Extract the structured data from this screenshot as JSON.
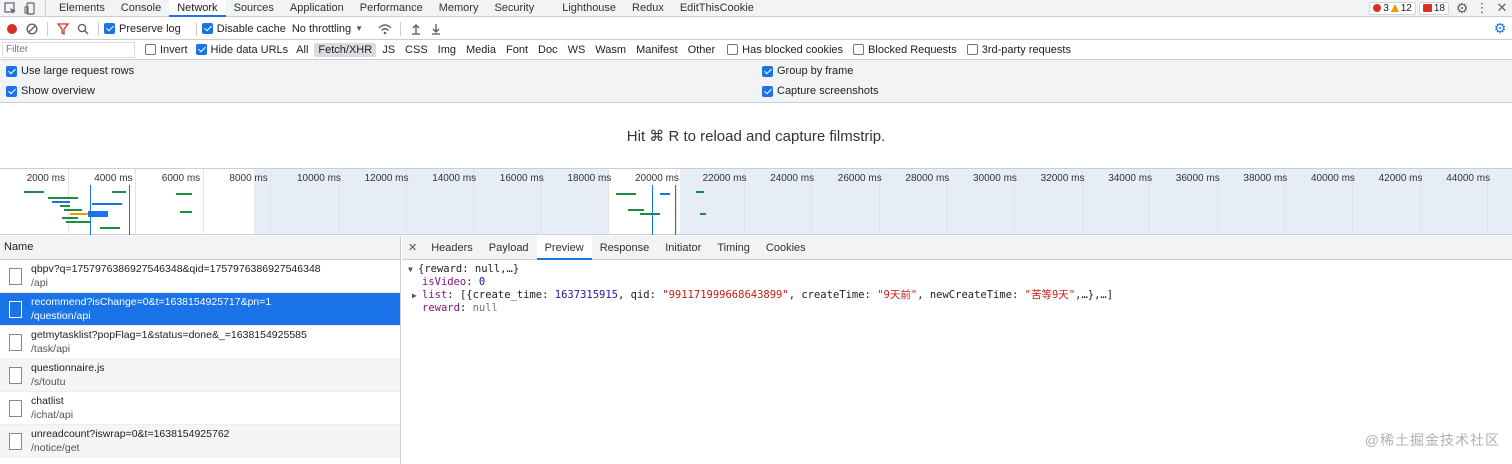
{
  "tabs": [
    {
      "label": "Elements",
      "active": false
    },
    {
      "label": "Console",
      "active": false
    },
    {
      "label": "Network",
      "active": true
    },
    {
      "label": "Sources",
      "active": false
    },
    {
      "label": "Application",
      "active": false
    },
    {
      "label": "Performance",
      "active": false
    },
    {
      "label": "Memory",
      "active": false
    },
    {
      "label": "Security",
      "active": false
    },
    {
      "label": "Lighthouse",
      "active": false
    },
    {
      "label": "Redux",
      "active": false
    },
    {
      "label": "EditThisCookie",
      "active": false
    }
  ],
  "badges": {
    "errors": "3",
    "warnings": "12",
    "issues": "18"
  },
  "toolbar": {
    "preserve_log": "Preserve log",
    "disable_cache": "Disable cache",
    "throttling": "No throttling"
  },
  "filter": {
    "placeholder": "Filter",
    "invert": "Invert",
    "hide_data_urls": "Hide data URLs",
    "types": [
      "All",
      "Fetch/XHR",
      "JS",
      "CSS",
      "Img",
      "Media",
      "Font",
      "Doc",
      "WS",
      "Wasm",
      "Manifest",
      "Other"
    ],
    "selected_type": "Fetch/XHR",
    "has_blocked_cookies": "Has blocked cookies",
    "blocked_requests": "Blocked Requests",
    "third_party": "3rd-party requests"
  },
  "settings": {
    "large_rows": "Use large request rows",
    "show_overview": "Show overview",
    "group_by_frame": "Group by frame",
    "capture_screenshots": "Capture screenshots"
  },
  "filmstrip": {
    "message": "Hit ⌘ R to reload and capture filmstrip."
  },
  "timeline": {
    "ticks": [
      "2000 ms",
      "4000 ms",
      "6000 ms",
      "8000 ms",
      "10000 ms",
      "12000 ms",
      "14000 ms",
      "16000 ms",
      "18000 ms",
      "20000 ms",
      "22000 ms",
      "24000 ms",
      "26000 ms",
      "28000 ms",
      "30000 ms",
      "32000 ms",
      "34000 ms",
      "36000 ms",
      "38000 ms",
      "40000 ms",
      "42000 ms",
      "44000 ms"
    ]
  },
  "list": {
    "header": "Name",
    "requests": [
      {
        "name": "qbpv?q=1757976386927546348&qid=1757976386927546348",
        "path": "/api"
      },
      {
        "name": "recommend?isChange=0&t=1638154925717&pn=1",
        "path": "/question/api"
      },
      {
        "name": "getmytasklist?popFlag=1&status=done&_=1638154925585",
        "path": "/task/api"
      },
      {
        "name": "questionnaire.js",
        "path": "/s/toutu"
      },
      {
        "name": "chatlist",
        "path": "/ichat/api"
      },
      {
        "name": "unreadcount?iswrap=0&t=1638154925762",
        "path": "/notice/get"
      }
    ]
  },
  "detail": {
    "tabs": [
      "Headers",
      "Payload",
      "Preview",
      "Response",
      "Initiator",
      "Timing",
      "Cookies"
    ],
    "active_tab": "Preview",
    "preview": {
      "root": "{reward: null,…}",
      "isVideo_key": "isVideo",
      "isVideo_val": "0",
      "list_key": "list",
      "list_val_open": "[{create_time: ",
      "list_num": "1637315915",
      "list_qid_key": ", qid: ",
      "list_qid": "\"991171999668643899\"",
      "list_ct_key": ", createTime: ",
      "list_ct": "\"9天前\"",
      "list_nct_key": ", newCreateTime: ",
      "list_nct": "\"苦等9天\"",
      "list_tail": ",…},…]",
      "reward_key": "reward",
      "reward_val": "null"
    }
  },
  "watermark": "@稀土掘金技术社区"
}
